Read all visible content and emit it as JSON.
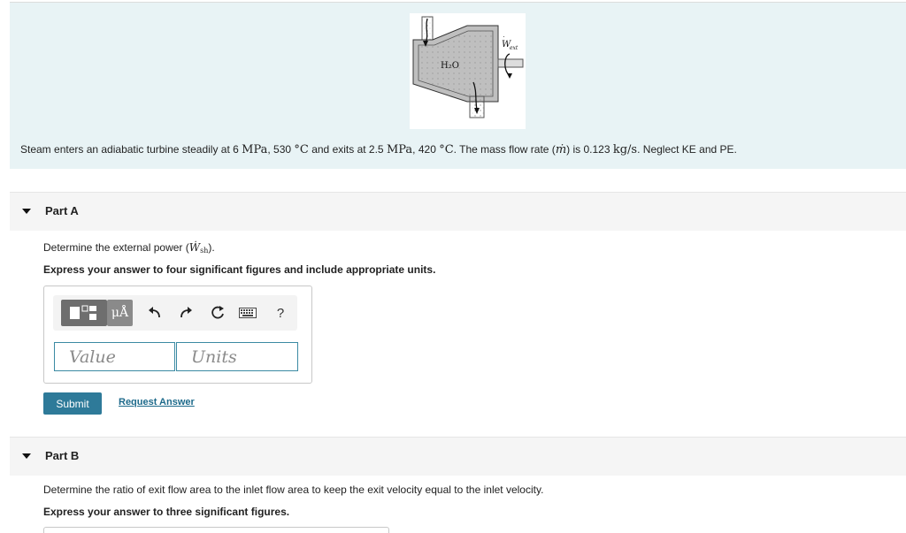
{
  "problem": {
    "figure_labels": {
      "fluid": "H₂O",
      "work": "W",
      "work_sub": "ext"
    },
    "text_prefix": "Steam enters an adiabatic turbine steadily at 6 ",
    "p1_unit": "MPa",
    "text_mid1": ", 530 ",
    "t1_unit": "°C",
    "text_mid2": " and exits at 2.5 ",
    "p2_unit": "MPa",
    "text_mid3": ", 420 ",
    "t2_unit": "°C",
    "text_mid4": ". The mass flow rate (",
    "mdot": "ṁ",
    "text_mid5": ") is 0.123 ",
    "mdot_unit": "kg/s",
    "text_suffix": ". Neglect KE and PE."
  },
  "part_a": {
    "title": "Part A",
    "question_prefix": "Determine the external power (",
    "question_symbol": "Ẇ",
    "question_sub": "sh",
    "question_suffix": ").",
    "instruction": "Express your answer to four significant figures and include appropriate units.",
    "toolbar": {
      "mu_label": "μÅ",
      "undo_icon": "undo-icon",
      "redo_icon": "redo-icon",
      "reset_icon": "reset-icon",
      "keyboard_icon": "keyboard-icon",
      "help_label": "?"
    },
    "value_placeholder": "Value",
    "units_placeholder": "Units",
    "submit_label": "Submit",
    "request_label": "Request Answer"
  },
  "part_b": {
    "title": "Part B",
    "question": "Determine the ratio of exit flow area to the inlet flow area to keep the exit velocity equal to the inlet velocity.",
    "instruction": "Express your answer to three significant figures."
  },
  "colors": {
    "problem_bg": "#e8f3f5",
    "submit_bg": "#2e7a99",
    "field_border": "#3b8aa3",
    "link": "#1d6a8b"
  }
}
